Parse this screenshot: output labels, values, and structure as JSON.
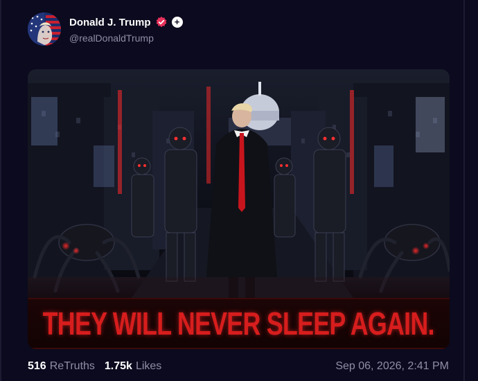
{
  "author": {
    "name": "Donald J. Trump",
    "handle": "@realDonaldTrump",
    "verified_color": "#e8315b",
    "plus_badge": "+"
  },
  "media": {
    "caption": "THEY WILL NEVER SLEEP AGAIN."
  },
  "stats": {
    "retruths_count": "516",
    "retruths_label": "ReTruths",
    "likes_count": "1.75k",
    "likes_label": "Likes"
  },
  "timestamp": "Sep 06, 2026, 2:41 PM",
  "colors": {
    "background": "#0b0a1e",
    "muted_text": "#8f8ea8",
    "caption_red": "#d71d1d"
  }
}
